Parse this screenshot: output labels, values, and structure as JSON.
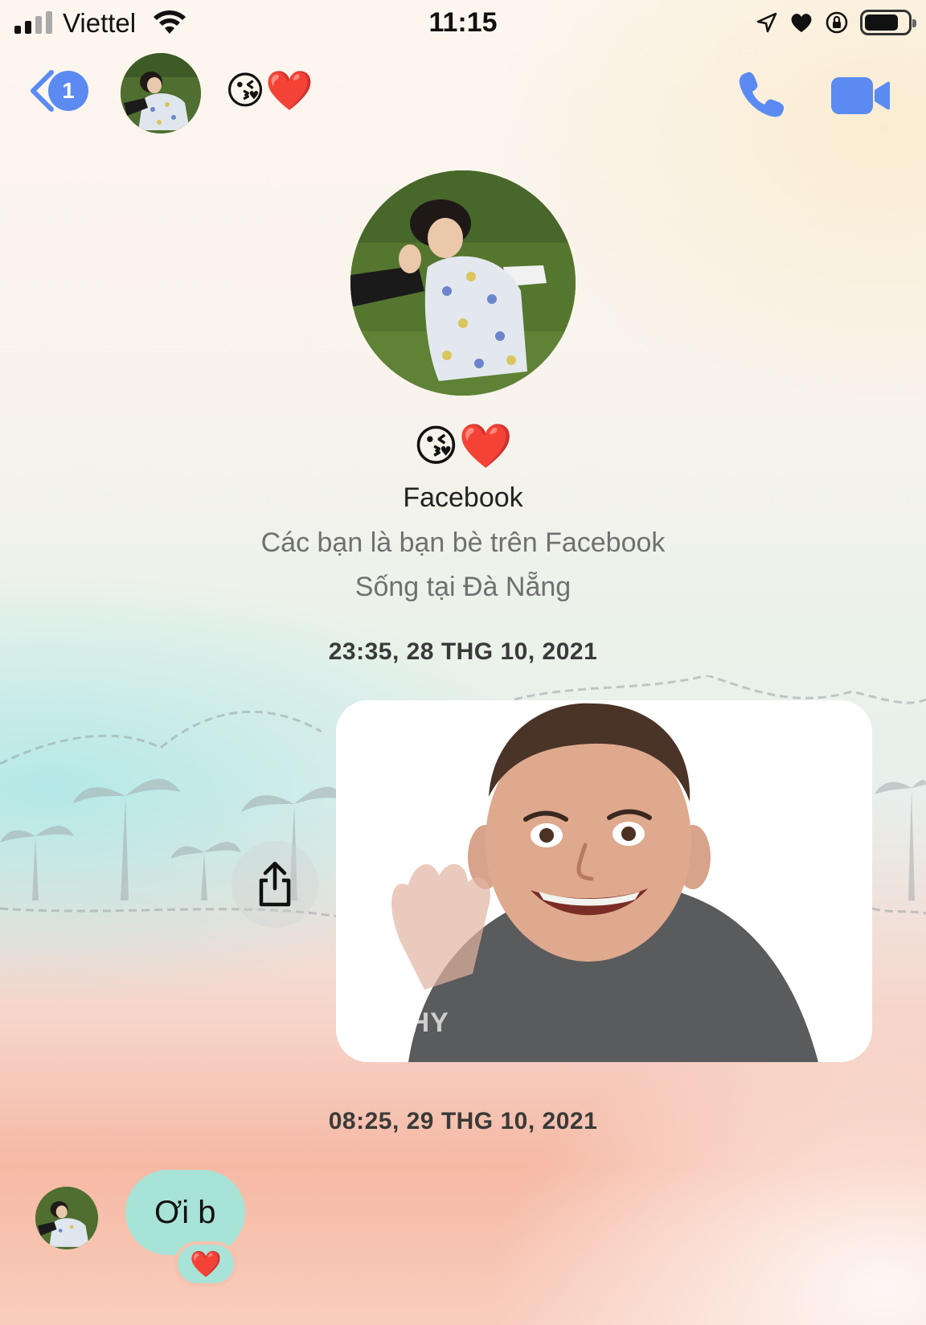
{
  "status_bar": {
    "carrier": "Viettel",
    "time": "11:15",
    "signal_bars": 2,
    "battery_level": 0.78
  },
  "header": {
    "back_badge": "1",
    "title": "😘❤️",
    "icons": [
      "chevron-left-icon",
      "phone-icon",
      "video-camera-icon"
    ],
    "accent_color": "#5b8bf2"
  },
  "profile": {
    "emoji_name": "😘❤️",
    "platform": "Facebook",
    "friends_text": "Các bạn là bạn bè trên Facebook",
    "location_text": "Sống tại Đà Nẵng"
  },
  "messages": {
    "timestamp_1": "23:35, 28 THG 10, 2021",
    "gif_watermark": "GIPHY",
    "timestamp_2": "08:25, 29 THG 10, 2021",
    "incoming_text": "Ơi b",
    "reaction": "❤️",
    "bubble_color": "#a7e3d6"
  }
}
